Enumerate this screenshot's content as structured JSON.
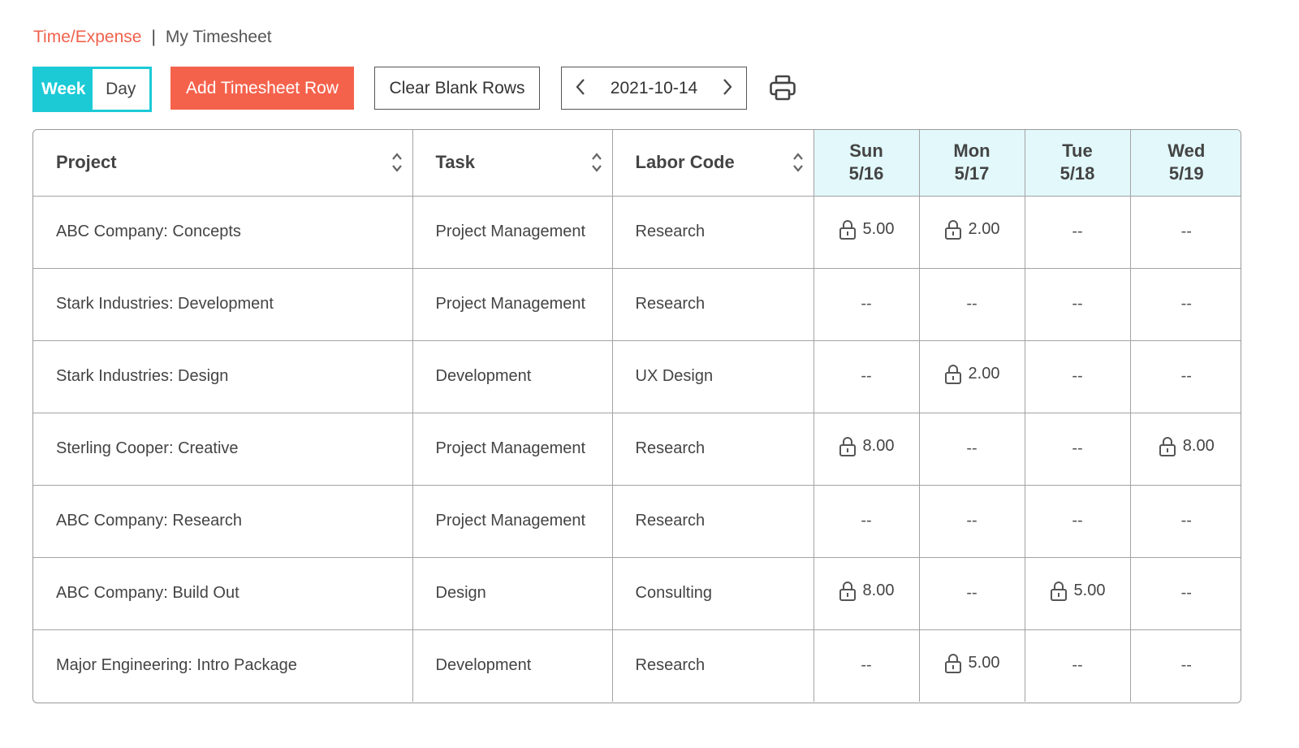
{
  "breadcrumb": {
    "parent": "Time/Expense",
    "separator": "|",
    "current": "My Timesheet"
  },
  "toolbar": {
    "view_toggle": {
      "week_label": "Week",
      "day_label": "Day",
      "selected": "Week"
    },
    "add_row_label": "Add Timesheet Row",
    "clear_blank_label": "Clear Blank Rows",
    "date": "2021-10-14",
    "prev_icon": "chevron-left-icon",
    "next_icon": "chevron-right-icon",
    "print_icon": "printer-icon"
  },
  "colors": {
    "accent": "#1ccad6",
    "primary_button": "#f5624c",
    "breadcrumb_link": "#f0624d",
    "day_header_bg": "#e2f8fa"
  },
  "table": {
    "columns": {
      "project": "Project",
      "task": "Task",
      "labor_code": "Labor Code"
    },
    "days": [
      {
        "name": "Sun",
        "date": "5/16"
      },
      {
        "name": "Mon",
        "date": "5/17"
      },
      {
        "name": "Tue",
        "date": "5/18"
      },
      {
        "name": "Wed",
        "date": "5/19"
      }
    ],
    "rows": [
      {
        "project": "ABC Company: Concepts",
        "task": "Project Management",
        "labor_code": "Research",
        "hours": [
          "5.00",
          "2.00",
          "--",
          "--"
        ]
      },
      {
        "project": "Stark Industries: Development",
        "task": "Project Management",
        "labor_code": "Research",
        "hours": [
          "--",
          "--",
          "--",
          "--"
        ]
      },
      {
        "project": "Stark Industries: Design",
        "task": "Development",
        "labor_code": "UX Design",
        "hours": [
          "--",
          "2.00",
          "--",
          "--"
        ]
      },
      {
        "project": "Sterling Cooper: Creative",
        "task": "Project Management",
        "labor_code": "Research",
        "hours": [
          "8.00",
          "--",
          "--",
          "8.00"
        ]
      },
      {
        "project": "ABC Company: Research",
        "task": "Project Management",
        "labor_code": "Research",
        "hours": [
          "--",
          "--",
          "--",
          "--"
        ]
      },
      {
        "project": "ABC Company: Build Out",
        "task": "Design",
        "labor_code": "Consulting",
        "hours": [
          "8.00",
          "--",
          "5.00",
          "--"
        ]
      },
      {
        "project": "Major Engineering: Intro Package",
        "task": "Development",
        "labor_code": "Research",
        "hours": [
          "--",
          "5.00",
          "--",
          "--"
        ]
      }
    ]
  }
}
